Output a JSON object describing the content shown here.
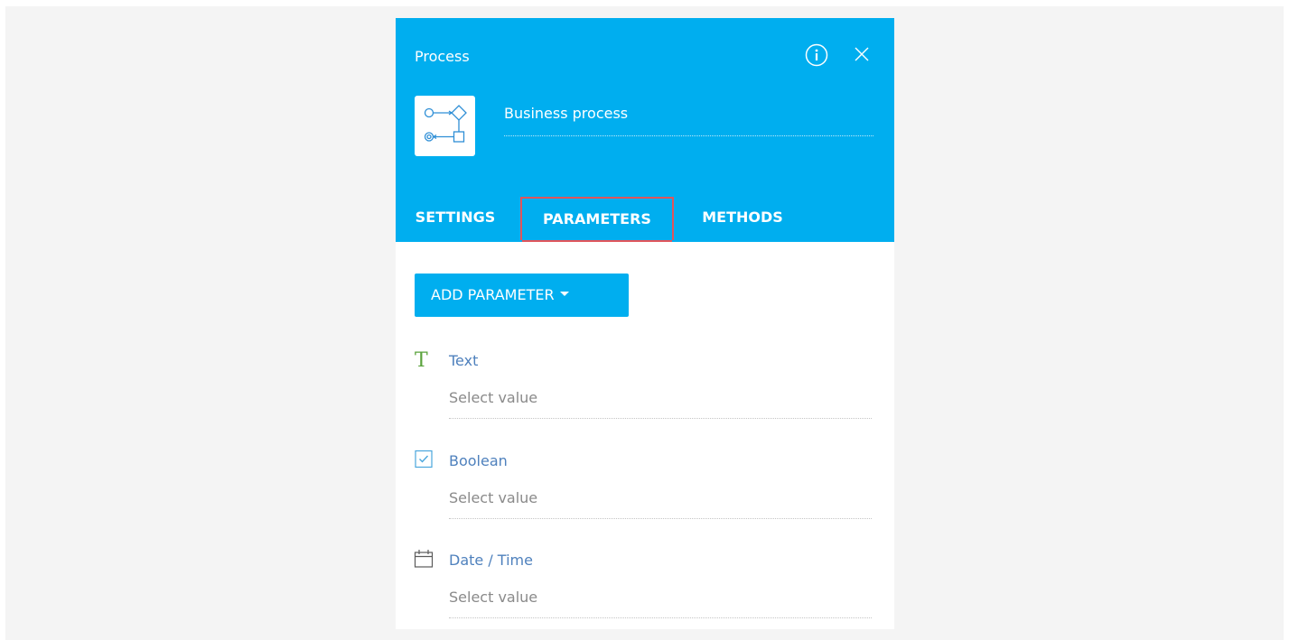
{
  "panel": {
    "title": "Process",
    "process_name": "Business process",
    "header_color": "#00aeef"
  },
  "header_icons": {
    "info": "info-icon",
    "close": "close-icon",
    "process": "business-process-icon"
  },
  "tabs": [
    {
      "label": "SETTINGS",
      "active": false
    },
    {
      "label": "PARAMETERS",
      "active": true
    },
    {
      "label": "METHODS",
      "active": false
    }
  ],
  "add_button": {
    "label": "ADD PARAMETER"
  },
  "parameters": [
    {
      "label": "Text",
      "placeholder": "Select value",
      "icon": "text-type-icon"
    },
    {
      "label": "Boolean",
      "placeholder": "Select value",
      "icon": "checkbox-icon"
    },
    {
      "label": "Date / Time",
      "placeholder": "Select value",
      "icon": "calendar-icon"
    }
  ],
  "colors": {
    "accent": "#00aeef",
    "highlight": "#e0555b",
    "link": "#4f81bd",
    "text_icon": "#5aa33c"
  }
}
